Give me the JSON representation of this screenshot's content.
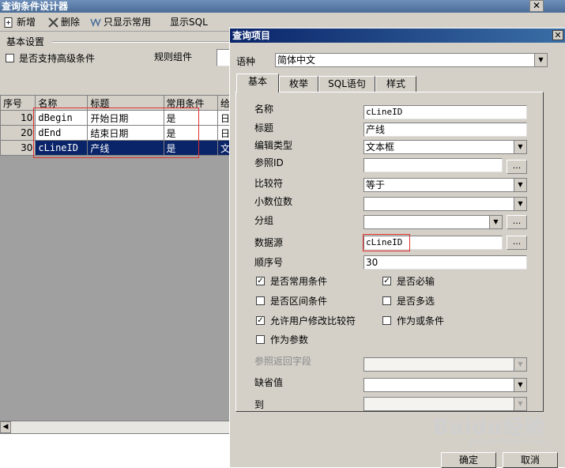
{
  "background_window": {
    "title": "查询条件设计器",
    "close_glyph": "✕",
    "toolbar": {
      "new_label": "新增",
      "delete_label": "删除",
      "show_common_label": "只显示常用",
      "show_sql_label": "显示SQL"
    },
    "settings": {
      "header": "基本设置",
      "advanced_label": "是否支持高级条件",
      "rule_component_label": "规则组件"
    },
    "grid": {
      "columns": [
        "序号",
        "名称",
        "标题",
        "常用条件",
        "给"
      ],
      "rows": [
        {
          "seq": "10",
          "name": "dBegin",
          "title": "开始日期",
          "common": "是",
          "extra": "日"
        },
        {
          "seq": "20",
          "name": "dEnd",
          "title": "结束日期",
          "common": "是",
          "extra": "日"
        },
        {
          "seq": "30",
          "name": "cLineID",
          "title": "产线",
          "common": "是",
          "extra": "文",
          "selected": true
        }
      ]
    }
  },
  "dialog": {
    "title": "查询项目",
    "language_label": "语种",
    "language_value": "简体中文",
    "tabs": [
      "基本",
      "枚举",
      "SQL语句",
      "样式"
    ],
    "active_tab": "基本",
    "fields": {
      "name_label": "名称",
      "name_value": "cLineID",
      "title_label": "标题",
      "title_value": "产线",
      "edit_type_label": "编辑类型",
      "edit_type_value": "文本框",
      "ref_id_label": "参照ID",
      "ref_id_value": "",
      "comparator_label": "比较符",
      "comparator_value": "等于",
      "decimals_label": "小数位数",
      "decimals_value": "",
      "group_label": "分组",
      "group_value": "",
      "datasource_label": "数据源",
      "datasource_value": "cLineID",
      "order_label": "顺序号",
      "order_value": "30",
      "ref_return_label": "参照返回字段",
      "ref_return_value": "",
      "default_label": "缺省值",
      "default_value": "",
      "to_label": "到",
      "to_value": ""
    },
    "checkboxes": {
      "common": {
        "label": "是否常用条件",
        "checked": true
      },
      "required": {
        "label": "是否必输",
        "checked": true
      },
      "range": {
        "label": "是否区间条件",
        "checked": false
      },
      "multi": {
        "label": "是否多选",
        "checked": false
      },
      "allow_modify": {
        "label": "允许用户修改比较符",
        "checked": true
      },
      "or_condition": {
        "label": "作为或条件",
        "checked": false
      },
      "as_param": {
        "label": "作为参数",
        "checked": false
      }
    },
    "dots_label": "...",
    "ok_label": "确定",
    "cancel_label": "取消"
  },
  "watermark": {
    "text": "Baidu经验",
    "sub": "jingyan.baidu.com"
  }
}
